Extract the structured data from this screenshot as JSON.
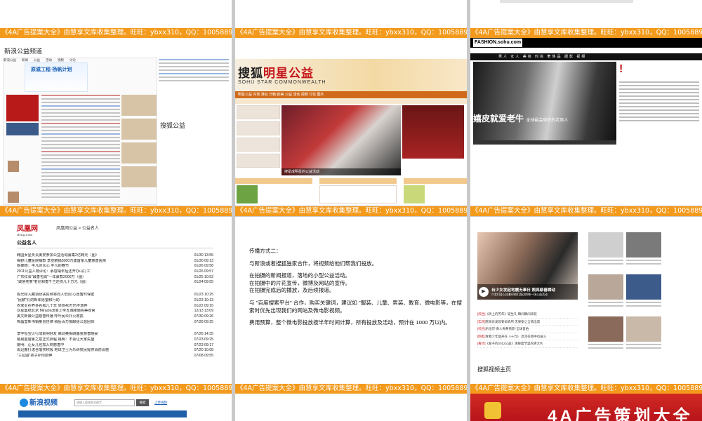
{
  "watermark": "《4A广告提案大全》由慧享文库收集整理。旺旺：ybxx310，QQ：100588900，89988368",
  "sina": {
    "title": "新浪公益频道",
    "nav": [
      "新浪公益",
      "新闻",
      "公益",
      "活动",
      "视频",
      "讨论"
    ],
    "banner": "原滋工程·扬帆计划",
    "caption": "搜狐公益"
  },
  "sohu_star": {
    "logo_main": "搜狐",
    "logo_accent": "明星公益",
    "subtitle": "SOHU STAR COMMONWEALTH",
    "nav": "明星公益  内地  港台  日韩  欧美  公益  活动  视频  讨论  图片",
    "photo_caption": "搜星成明星的公益活动"
  },
  "fashion": {
    "logo": "FASHION.sohu.com",
    "nav": "男人  女人  美容  时尚  奢侈品  摄影  视频",
    "photo_caption": "嬉皮就爱老牛",
    "photo_subcaption": "全球最会穿衣的老男人",
    "hot_mark": "!"
  },
  "ifeng": {
    "logo": "凤凰网",
    "logo_sub": "ifeng.com",
    "crumb": "凤凰网公益 > 公益名人",
    "heading": "公益名人",
    "items": [
      {
        "title": "韩国女星负责美爱参加公益活动募集2亿韩元（图）",
        "date": "01/30 13:55"
      },
      {
        "title": "揭野儿童医院捐款 李亚鹏捐3000万建首家儿童慈善医院",
        "date": "01/30 09:13"
      },
      {
        "title": "陈葆她：平凡的众心 平凡的春节",
        "date": "01/26 09:58"
      },
      {
        "title": "2011公益人物评论：慕容娟年后还开办山打工",
        "date": "01/26 09:57"
      },
      {
        "title": "广东红会\"最善包斑\"一年募款2000万（图）",
        "date": "01/25 10:52"
      },
      {
        "title": "\"诚信老爹\"老伦和善千兰还债几十万元（图）",
        "date": "01/24 09:55"
      },
      {
        "title": "",
        "date": ""
      },
      {
        "title": "陈光标入藏调研扶贫称将向人低调 心愿暂时保密",
        "date": "01/23 10:25"
      },
      {
        "title": "\"民鹏\"们的新年愿望和行动",
        "date": "01/23 10:13"
      },
      {
        "title": "农家女在养多名孤儿十年 举债40万仍不放弃",
        "date": "01/22 09:15"
      },
      {
        "title": "众星集结北京 Miracle改变上学五城降施完美收官",
        "date": "12/13 13:09"
      },
      {
        "title": "美文新娘公益慈善传播 呼吁民众扑火救孤",
        "date": "07/30 09:26"
      },
      {
        "title": "陶晶莹新书销量创佳绩 稍后百万捐献给公益团体",
        "date": "07/28 09:25"
      },
      {
        "title": "",
        "date": ""
      },
      {
        "title": "李宇恒宝贝行成就明好友 高调亮相跳基金慈善晚宴",
        "date": "07/26 14:35"
      },
      {
        "title": "姚晨金爸鲁之意正式启程 姚明：不会让大家失望",
        "date": "07/23 09:25"
      },
      {
        "title": "姚明：让女儿也加入到慈善中",
        "date": "07/23 09:17"
      },
      {
        "title": "周迅搬打诺含落实积极 地球卫士为乐树贫民提供消防设施",
        "date": "07/20 10:08"
      },
      {
        "title": "\"三拉圈\"孩子扑你前伸",
        "date": "07/08 09:55"
      }
    ]
  },
  "text": {
    "paragraphs": [
      "传播方式二：",
      "与新浪或者搜狐独家合作，将视频给他们帮我们投放。",
      "在拍摄的新闻报道，落地的小型公益活动。\n在拍摄中的片花宣传，微博及网站的宣传。\n在拍摄完成后的播放，及后续报道。",
      "与 \"百度搜索平台\" 合作，购买关键词，建议如 \"服装、儿童、男装、教育、微电影等，在搜索时优先出现我们的网站及微电影视频。",
      "费用预算，整个微电影投放按半年时间计算，所有投放及活动，预计在 1000 万以内。"
    ]
  },
  "video": {
    "main_caption": "台少女发起地震无辜日 照亮慈善瞬动",
    "main_subcaption": "少女们身上挂着印他们身边的每一场公益活动",
    "list": [
      {
        "tag": "[综合]",
        "text": "《听上的芳年》诞生礼 瞬间瞬间华装"
      },
      {
        "tag": "[实况]",
        "text": "陈锐东发现安如去所 无果安之全情出席"
      },
      {
        "tag": "[综合]",
        "text": "乐恒可\"真人秀慈善影\"全球首拍"
      },
      {
        "tag": "[网友]",
        "text": "青春少年盛开在《十万》 高鸿在雨中也奋斗"
      },
      {
        "tag": "[看点]",
        "text": "《爱子的2012公益》演绎着节里的清大片"
      }
    ],
    "label": "搜狐视频主页"
  },
  "sina_video": {
    "logo": "新浪视频",
    "search_placeholder": "请输入要搜索关键字",
    "search_button": "搜索",
    "link": "上传视频"
  },
  "ad": {
    "title": "4A广告策划大全"
  }
}
